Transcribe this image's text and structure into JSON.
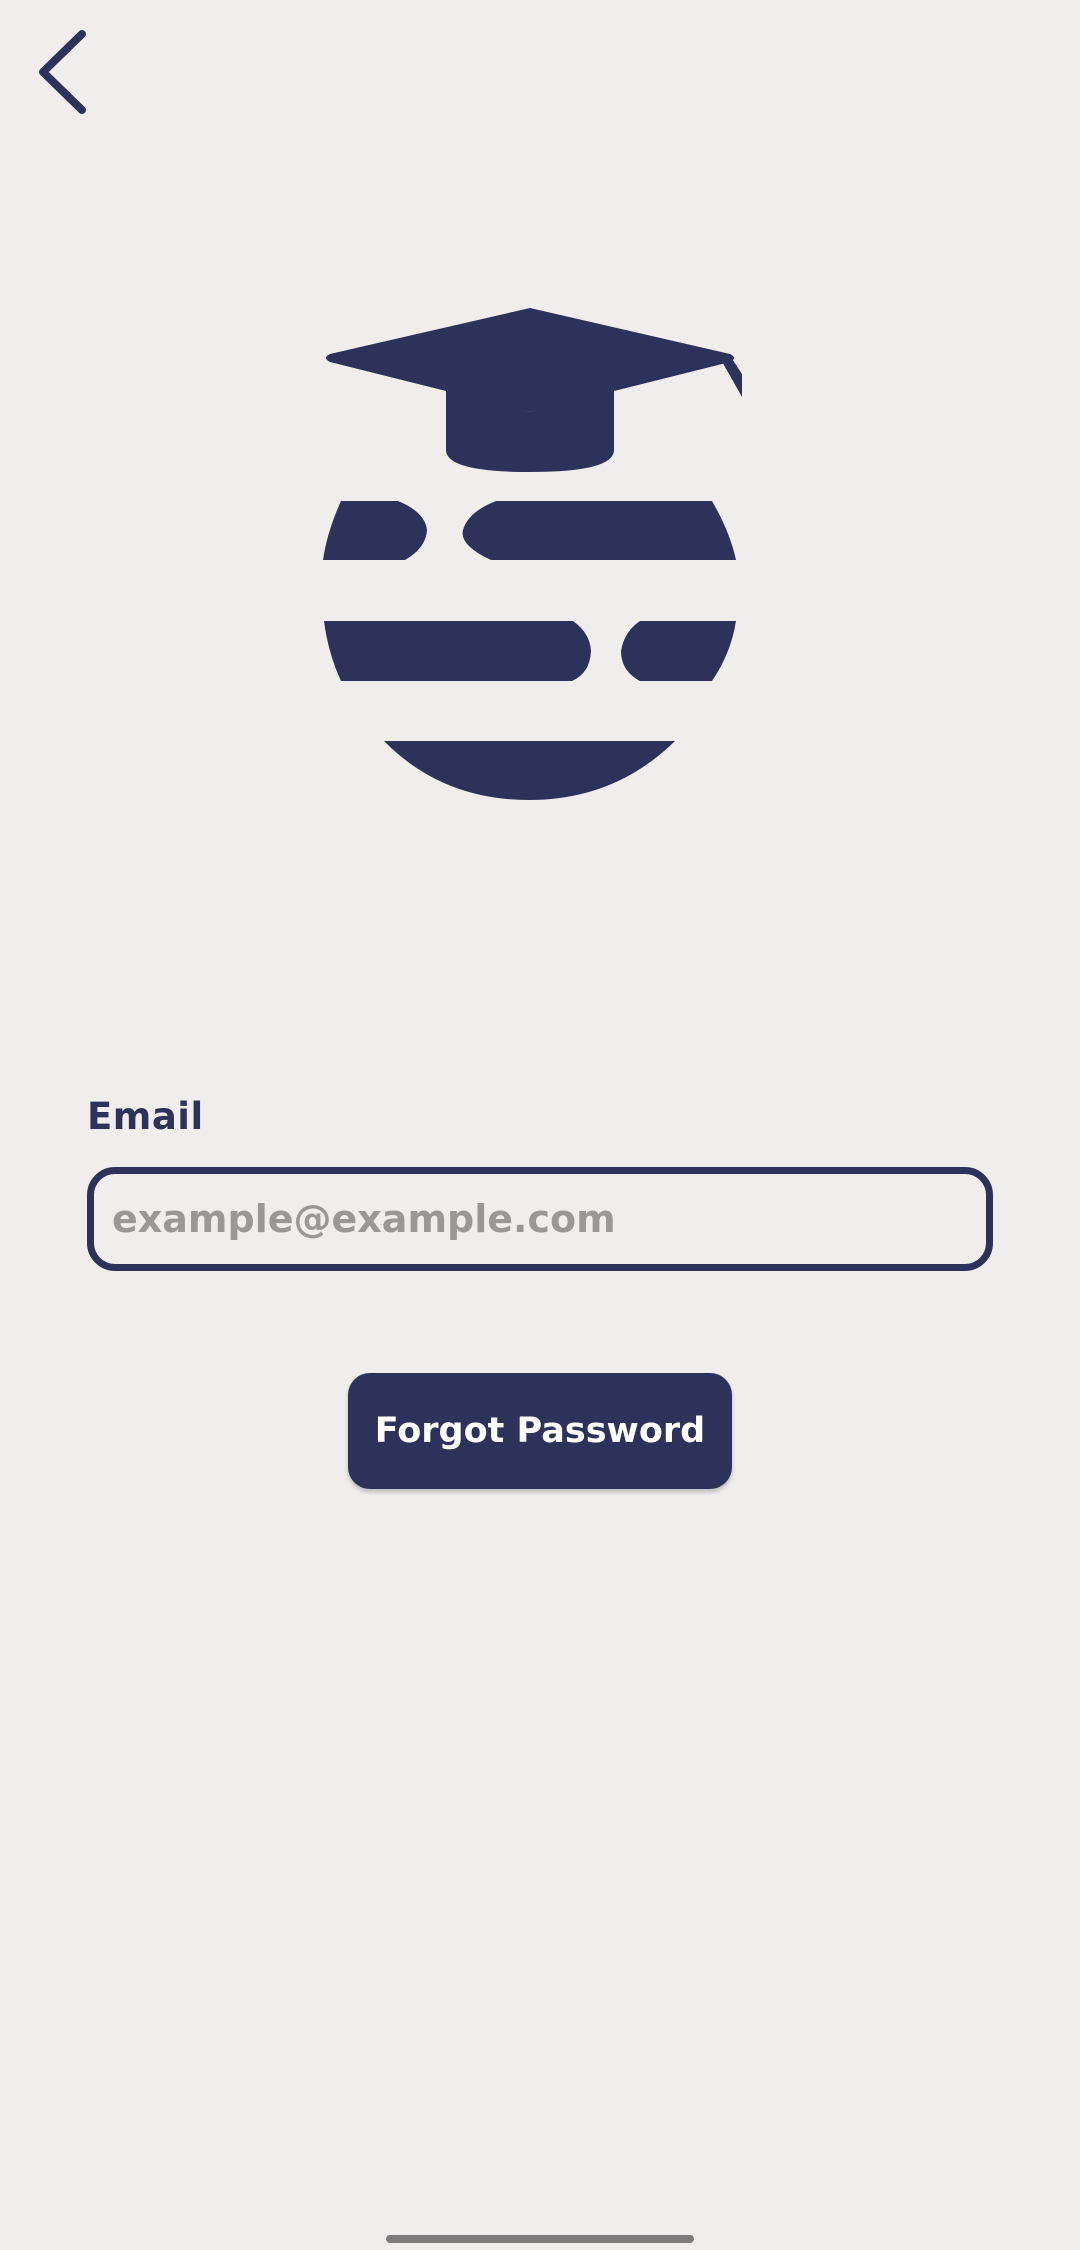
{
  "nav": {
    "back_icon": "chevron-left-icon"
  },
  "logo": {
    "icon": "graduation-cap-globe-icon",
    "color": "#2D325A"
  },
  "form": {
    "email_label": "Email",
    "email_value": "",
    "email_placeholder": "example@example.com",
    "submit_label": "Forgot Password"
  },
  "colors": {
    "background": "#F0EEED",
    "accent": "#2D325A",
    "placeholder": "#9A9897",
    "button_text": "#FFFFFF"
  }
}
